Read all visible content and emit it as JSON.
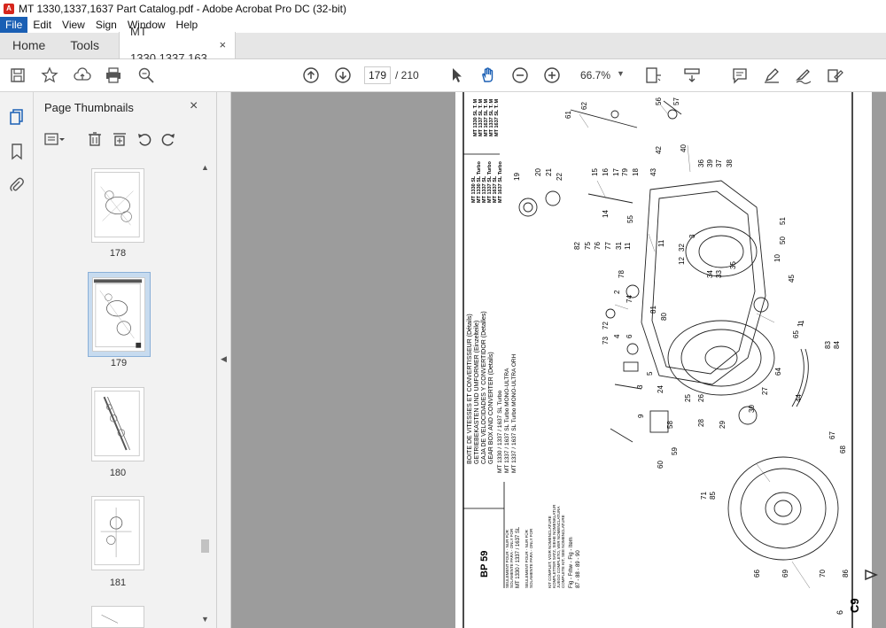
{
  "window": {
    "title": "MT 1330,1337,1637 Part Catalog.pdf - Adobe Acrobat Pro DC (32-bit)",
    "app_icon": "acrobat-icon"
  },
  "menu": {
    "items": [
      "File",
      "Edit",
      "View",
      "Sign",
      "Window",
      "Help"
    ],
    "active_index": 0
  },
  "tabs": {
    "home": "Home",
    "tools": "Tools",
    "document": "MT 1330,1337,163...",
    "document_close": "×"
  },
  "toolbar": {
    "icons": [
      "save-icon",
      "bookmark-star-icon",
      "cloud-upload-icon",
      "print-icon",
      "search-zoom-icon",
      "previous-page-icon",
      "next-page-icon",
      "select-cursor-icon",
      "hand-tool-icon",
      "zoom-out-icon",
      "zoom-in-icon",
      "fit-page-icon",
      "scroll-mode-icon",
      "comment-icon",
      "highlight-pen-icon",
      "sign-icon",
      "edit-pdf-icon"
    ],
    "current_page": "179",
    "page_total": "/ 210",
    "zoom": "66.7%",
    "active_tool": "hand-tool-icon",
    "accent_color": "#1a5fb4"
  },
  "left_rail": {
    "icons": [
      "page-thumbnails-icon",
      "bookmarks-icon",
      "attachments-icon"
    ]
  },
  "thumbnails_panel": {
    "title": "Page Thumbnails",
    "close": "×",
    "tools": [
      "options-menu-icon",
      "delete-page-icon",
      "insert-page-icon",
      "rotate-ccw-icon",
      "rotate-cw-icon"
    ],
    "pages": [
      {
        "label": "178",
        "selected": false
      },
      {
        "label": "179",
        "selected": true
      },
      {
        "label": "180",
        "selected": false
      },
      {
        "label": "181",
        "selected": false
      }
    ]
  },
  "document": {
    "header_models": [
      "MT 1330 SL",
      "MT 1330 SL Turbo",
      "MT 1337 SL",
      "MT 1337 SL Turbo",
      "MT 1637 SL",
      "MT 1637 SL Turbo"
    ],
    "header_models_right": [
      "MT 1330 SL T. M",
      "MT 1337 SL T. M",
      "MT 1637 SL T. M",
      "MT 1337 SL T. M",
      "MT 1637 SL T. M"
    ],
    "titles": [
      "BOITE DE VITESSES ET CONVERTISSEUR (Détails)",
      "GETRIEBEKASTEN UND UMFORMER (Einzelteile)",
      "CAJA DE VELOCIDADES Y CONVERTIDOR (Detalles)",
      "GEAR BOX AND CONVERTER (Details)"
    ],
    "subtitles": [
      "MT 1330 / 1337 / 1637 SL Turbo",
      "MT 1337 / 1637 SL Turbo MONO-ULTRA",
      "MT 1337 / 1637 SL Turbo MONO-ULTRA ORH"
    ],
    "legend_lines": [
      "SEULEMENT POUR - NUR FÜR",
      "SOLAMENTE PARA - ONLY FOR",
      "MT 1330 / 1337 / 1637 SL"
    ],
    "legend_lines2": [
      "SEULEMENT POUR - NUR FÜR",
      "SOLAMENTE PARA - ONLY FOR"
    ],
    "kit_lines": [
      "KIT COMPLET, VOIR NOMENCLATURE",
      "KOMPLETTER SATZ, SIEHE NOMENKLATUR",
      "JUEGO COMPLETO, VER NOMENCLATURA",
      "COMPLETE KIT, SEE NOMENCLATURE"
    ],
    "fig_ref": "Fig - Frhw - Fig - Item",
    "fig_numbers": "87 - 88 - 89 - 90",
    "plate_code": "BP 59",
    "page_code": "C9",
    "page_number": "6",
    "callouts": [
      "61",
      "62",
      "56",
      "57",
      "42",
      "40",
      "36",
      "39",
      "37",
      "38",
      "19",
      "20",
      "21",
      "22",
      "15",
      "16",
      "17",
      "79",
      "18",
      "43",
      "14",
      "55",
      "82",
      "75",
      "76",
      "77",
      "31",
      "11",
      "3",
      "11",
      "32",
      "12",
      "51",
      "50",
      "10",
      "78",
      "2",
      "74",
      "72",
      "73",
      "4",
      "6",
      "81",
      "80",
      "5",
      "3",
      "35",
      "33",
      "34",
      "1",
      "45",
      "65",
      "83",
      "84",
      "1",
      "9",
      "24",
      "25",
      "26",
      "27",
      "64",
      "44",
      "28",
      "29",
      "30",
      "58",
      "59",
      "60",
      "67",
      "68",
      "71",
      "85",
      "66",
      "69",
      "70",
      "86"
    ]
  }
}
